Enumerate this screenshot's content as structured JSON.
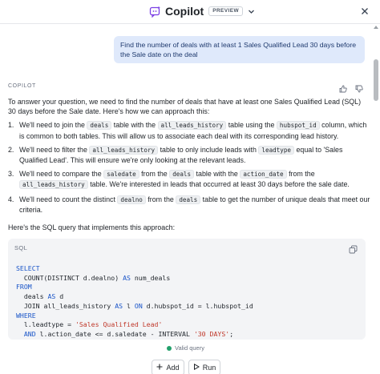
{
  "header": {
    "title": "Copilot",
    "badge": "PREVIEW"
  },
  "user_message": "Find the number of deals with at least 1 Sales Qualified Lead 30 days before the Sale date on the deal",
  "response": {
    "sender": "COPILOT",
    "intro": "To answer your question, we need to find the number of deals that have at least one Sales Qualified Lead (SQL) 30 days before the Sale date. Here's how we can approach this:",
    "steps": [
      {
        "n": "1.",
        "t1": "We'll need to join the ",
        "c1": "deals",
        "t2": " table with the ",
        "c2": "all_leads_history",
        "t3": " table using the ",
        "c3": "hubspot_id",
        "t4": " column, which is common to both tables. This will allow us to associate each deal with its corresponding lead history."
      },
      {
        "n": "2.",
        "t1": "We'll need to filter the ",
        "c1": "all_leads_history",
        "t2": " table to only include leads with ",
        "c2": "leadtype",
        "t3": " equal to 'Sales Qualified Lead'. This will ensure we're only looking at the relevant leads."
      },
      {
        "n": "3.",
        "t1": "We'll need to compare the ",
        "c1": "saledate",
        "t2": " from the ",
        "c2": "deals",
        "t3": " table with the ",
        "c3": "action_date",
        "t4": " from the ",
        "c4": "all_leads_history",
        "t5": " table. We're interested in leads that occurred at least 30 days before the sale date."
      },
      {
        "n": "4.",
        "t1": "We'll need to count the distinct ",
        "c1": "dealno",
        "t2": " from the ",
        "c2": "deals",
        "t3": " table to get the number of unique deals that meet our criteria."
      }
    ],
    "lead_in": "Here's the SQL query that implements this approach:"
  },
  "sql": {
    "label": "SQL",
    "lines": [
      [
        {
          "k": "SELECT"
        }
      ],
      [
        {
          "t": "  COUNT(DISTINCT d.dealno) "
        },
        {
          "k": "AS"
        },
        {
          "t": " num_deals"
        }
      ],
      [
        {
          "k": "FROM"
        }
      ],
      [
        {
          "t": "  deals "
        },
        {
          "k": "AS"
        },
        {
          "t": " d"
        }
      ],
      [
        {
          "t": "  JOIN all_leads_history "
        },
        {
          "k": "AS"
        },
        {
          "t": " l "
        },
        {
          "k": "ON"
        },
        {
          "t": " d.hubspot_id = l.hubspot_id"
        }
      ],
      [
        {
          "k": "WHERE"
        }
      ],
      [
        {
          "t": "  l.leadtype = "
        },
        {
          "s": "'Sales Qualified Lead'"
        }
      ],
      [
        {
          "t": "  "
        },
        {
          "k": "AND"
        },
        {
          "t": " l.action_date <= d.saledate - INTERVAL "
        },
        {
          "s": "'30 DAYS'"
        },
        {
          "t": ";"
        }
      ]
    ],
    "status": "Valid query"
  },
  "actions": {
    "add_label": "Add",
    "run_label": "Run"
  },
  "colors": {
    "accent": "#1a55c8",
    "user_bubble": "#dfe9fb",
    "valid": "#22a06b"
  }
}
